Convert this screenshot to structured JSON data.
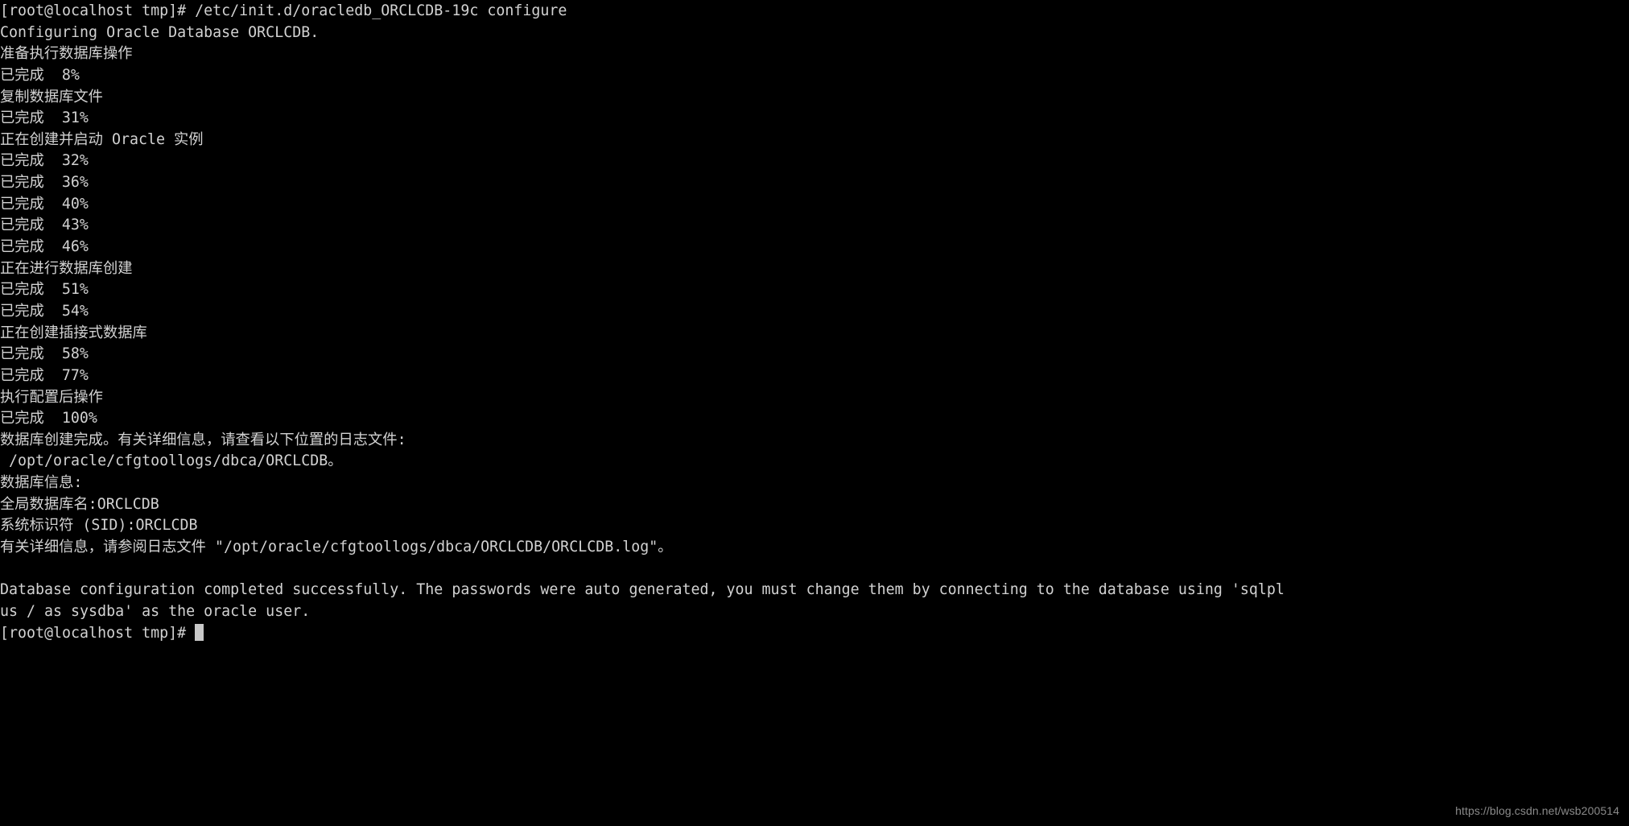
{
  "terminal": {
    "colors": {
      "background": "#000000",
      "foreground": "#d2d2d2",
      "cursor": "#c8c8c8",
      "watermark": "#8a8a8a"
    },
    "command": "/etc/init.d/oracledb_ORCLCDB-19c configure",
    "prompt": "[root@localhost tmp]#",
    "lines": [
      "[root@localhost tmp]# /etc/init.d/oracledb_ORCLCDB-19c configure",
      "Configuring Oracle Database ORCLCDB.",
      "准备执行数据库操作",
      "已完成  8%",
      "复制数据库文件",
      "已完成  31%",
      "正在创建并启动 Oracle 实例",
      "已完成  32%",
      "已完成  36%",
      "已完成  40%",
      "已完成  43%",
      "已完成  46%",
      "正在进行数据库创建",
      "已完成  51%",
      "已完成  54%",
      "正在创建插接式数据库",
      "已完成  58%",
      "已完成  77%",
      "执行配置后操作",
      "已完成  100%",
      "数据库创建完成。有关详细信息，请查看以下位置的日志文件:",
      " /opt/oracle/cfgtoollogs/dbca/ORCLCDB。",
      "数据库信息:",
      "全局数据库名:ORCLCDB",
      "系统标识符 (SID):ORCLCDB",
      "有关详细信息，请参阅日志文件 \"/opt/oracle/cfgtoollogs/dbca/ORCLCDB/ORCLCDB.log\"。",
      "",
      "Database configuration completed successfully. The passwords were auto generated, you must change them by connecting to the database using 'sqlpl",
      "us / as sysdba' as the oracle user."
    ],
    "progress_steps": [
      {
        "label": "准备执行数据库操作",
        "percent": 8
      },
      {
        "label": "复制数据库文件",
        "percent": 31
      },
      {
        "label": "正在创建并启动 Oracle 实例",
        "percent": 46
      },
      {
        "label": "正在进行数据库创建",
        "percent": 54
      },
      {
        "label": "正在创建插接式数据库",
        "percent": 77
      },
      {
        "label": "执行配置后操作",
        "percent": 100
      }
    ],
    "database_info": {
      "heading": "数据库信息:",
      "global_name_label": "全局数据库名",
      "global_name": "ORCLCDB",
      "sid_label": "系统标识符 (SID)",
      "sid": "ORCLCDB",
      "log_dir": "/opt/oracle/cfgtoollogs/dbca/ORCLCDB",
      "log_file": "/opt/oracle/cfgtoollogs/dbca/ORCLCDB/ORCLCDB.log"
    },
    "final_prompt": "[root@localhost tmp]#"
  },
  "watermark": {
    "text": "https://blog.csdn.net/wsb200514"
  }
}
